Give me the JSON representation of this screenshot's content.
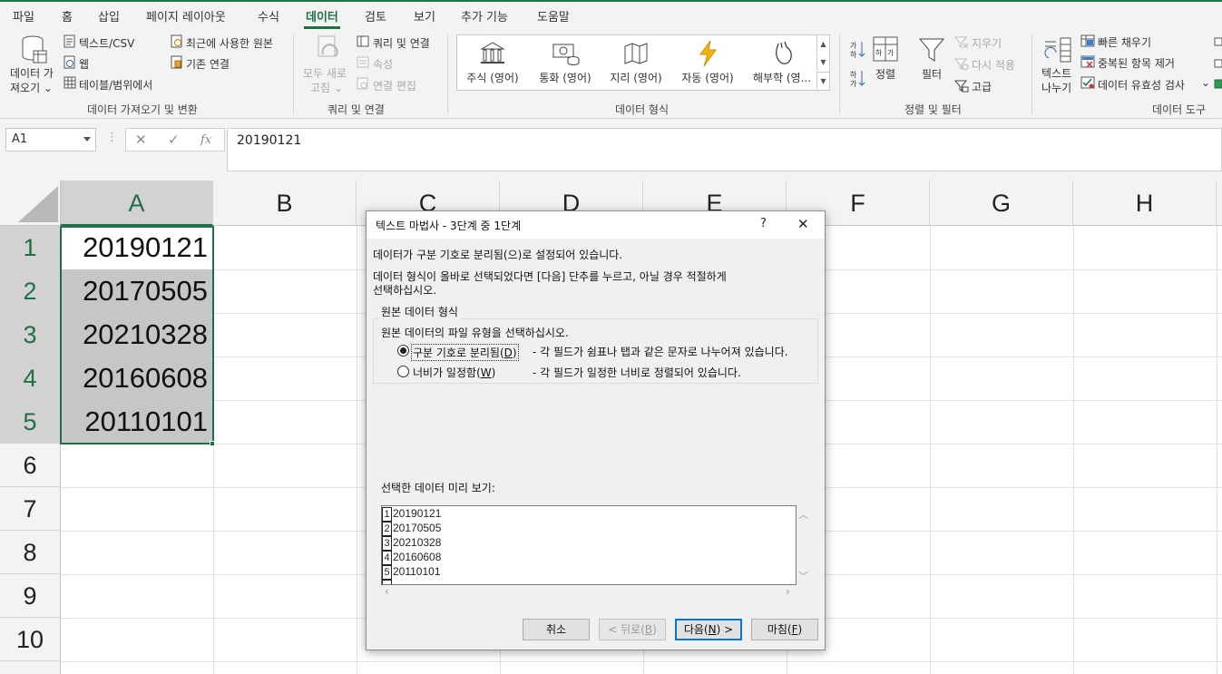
{
  "tabs": [
    "파일",
    "홈",
    "삽입",
    "페이지 레이아웃",
    "수식",
    "데이터",
    "검토",
    "보기",
    "추가 기능",
    "도움말"
  ],
  "active_tab": "데이터",
  "ribbon": {
    "get_data": {
      "big_button": [
        "데이터 가",
        "져오기 ⌄"
      ],
      "text_csv": "텍스트/CSV",
      "web": "웹",
      "table_range": "테이블/범위에서",
      "recent_sources": "최근에 사용한 원본",
      "existing_conn": "기존 연결",
      "label": "데이터 가져오기 및 변환"
    },
    "queries": {
      "refresh_all": [
        "모두 새로",
        "고침 ⌄"
      ],
      "queries_conn": "쿼리 및 연결",
      "properties": "속성",
      "edit_links": "연결 편집",
      "label": "쿼리 및 연결"
    },
    "data_types": {
      "items": [
        "주식 (영어)",
        "통화 (영어)",
        "지리 (영어)",
        "자동 (영어)",
        "해부학 (영..."
      ],
      "label": "데이터 형식"
    },
    "sort_filter": {
      "sort": "정렬",
      "filter": "필터",
      "clear": "지우기",
      "reapply": "다시 적용",
      "advanced": "고급",
      "label": "정렬 및 필터"
    },
    "data_tools": {
      "text_to_columns": [
        "텍스트",
        "나누기"
      ],
      "flash_fill": "빠른 채우기",
      "remove_dup": "중복된 항목 제거",
      "validation": "데이터 유효성 검사",
      "validation_caret": "⌄",
      "label": "데이터 도구"
    }
  },
  "formula_bar": {
    "name_box": "A1",
    "cancel": "✕",
    "enter": "✓",
    "fx": "fx",
    "value": "20190121"
  },
  "grid": {
    "columns": [
      "A",
      "B",
      "C",
      "D",
      "E",
      "F",
      "G",
      "H"
    ],
    "rows": [
      "1",
      "2",
      "3",
      "4",
      "5",
      "6",
      "7",
      "8",
      "9",
      "10"
    ],
    "col_a_values": [
      "20190121",
      "20170505",
      "20210328",
      "20160608",
      "20110101"
    ]
  },
  "dialog": {
    "title": "텍스트 마법사 - 3단계 중 1단계",
    "help": "?",
    "close": "✕",
    "line1": "데이터가 구분 기호로 분리됨(으)로 설정되어 있습니다.",
    "line2": "데이터 형식이 올바로 선택되었다면 [다음] 단추를 누르고, 아닐 경우 적절하게",
    "line3": "선택하십시오.",
    "group_title": "원본 데이터 형식",
    "group_prompt": "원본 데이터의 파일 유형을 선택하십시오.",
    "opt_delimited": {
      "label": "구분 기호로 분리됨",
      "key": "D",
      "desc": "- 각 필드가 쉼표나 탭과 같은 문자로 나누어져 있습니다.",
      "selected": true
    },
    "opt_fixed": {
      "label": "너비가 일정함",
      "key": "W",
      "desc": "- 각 필드가 일정한 너비로 정렬되어 있습니다.",
      "selected": false
    },
    "preview_label": "선택한 데이터 미리 보기:",
    "preview_rows": [
      {
        "n": "1",
        "v": "20190121"
      },
      {
        "n": "2",
        "v": "20170505"
      },
      {
        "n": "3",
        "v": "20210328"
      },
      {
        "n": "4",
        "v": "20160608"
      },
      {
        "n": "5",
        "v": "20110101"
      }
    ],
    "buttons": {
      "cancel": "취소",
      "back_label": "< 뒤로(",
      "back_key": "B",
      "next_label": "다음(",
      "next_key": "N",
      "next_tail": ") >",
      "finish_label": "마침(",
      "finish_key": "F",
      "close_paren": ")"
    }
  }
}
